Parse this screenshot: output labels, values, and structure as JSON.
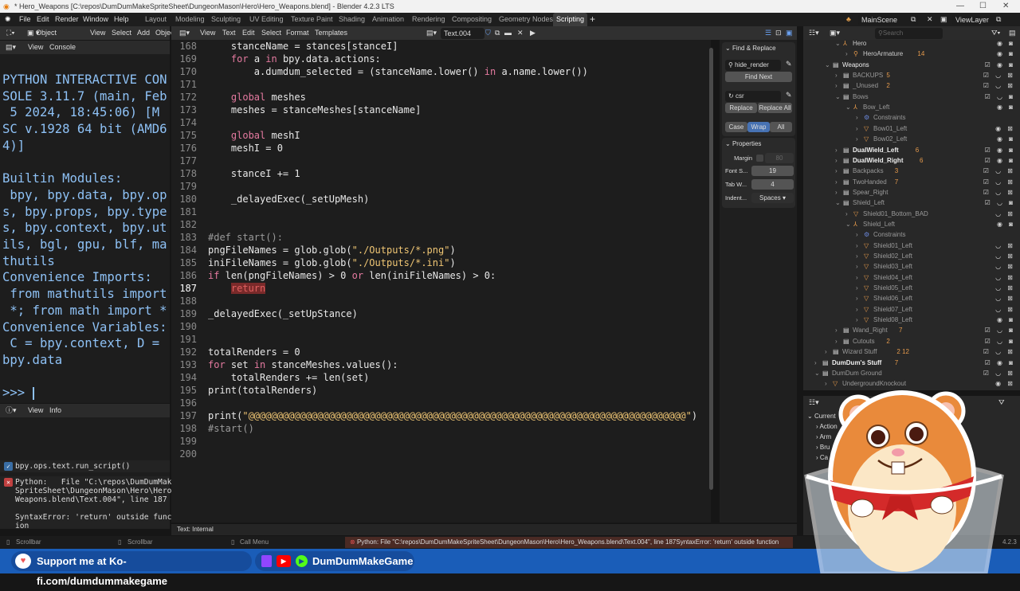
{
  "title": "* Hero_Weapons [C:\\repos\\DumDumMakeSpriteSheet\\DungeonMason\\Hero\\Hero_Weapons.blend] - Blender 4.2.3 LTS",
  "menu": [
    "File",
    "Edit",
    "Render",
    "Window",
    "Help"
  ],
  "workspaces": [
    "Layout",
    "Modeling",
    "Sculpting",
    "UV Editing",
    "Texture Paint",
    "Shading",
    "Animation",
    "Rendering",
    "Compositing",
    "Geometry Nodes",
    "Scripting"
  ],
  "active_workspace": "Scripting",
  "scene": "MainScene",
  "view_layer": "ViewLayer",
  "viewport_header": {
    "mode": "Object Mode",
    "items": [
      "View",
      "Select",
      "Add",
      "Objec"
    ]
  },
  "console_header": {
    "items": [
      "View",
      "Console"
    ]
  },
  "console_text": "PYTHON INTERACTIVE CON\nSOLE 3.11.7 (main, Feb\n 5 2024, 18:45:06) [M\nSC v.1928 64 bit (AMD6\n4)]\n\nBuiltin Modules:\n bpy, bpy.data, bpy.op\ns, bpy.props, bpy.type\ns, bpy.context, bpy.ut\nils, bgl, gpu, blf, ma\nthutils\nConvenience Imports:\n from mathutils import\n *; from math import *\nConvenience Variables:\n C = bpy.context, D =\nbpy.data\n\n>>> ",
  "info_header": {
    "items": [
      "View",
      "Info"
    ]
  },
  "info": {
    "op": "bpy.ops.text.run_script()",
    "error": "Python:   File \"C:\\repos\\DumDumMake\nSpriteSheet\\DungeonMason\\Hero\\Hero_\nWeapons.blend\\Text.004\", line 187\n\nSyntaxError: 'return' outside funct\nion"
  },
  "text_header": {
    "items": [
      "View",
      "Text",
      "Edit",
      "Select",
      "Format",
      "Templates"
    ],
    "datablock": "Text.004"
  },
  "text_footer": "Text: Internal",
  "code": [
    {
      "n": "168",
      "t": [
        [
          "",
          "    stanceName = stances[stanceI]"
        ]
      ]
    },
    {
      "n": "169",
      "t": [
        [
          "",
          "    "
        ],
        [
          "k",
          "for"
        ],
        [
          "",
          " a "
        ],
        [
          "k",
          "in"
        ],
        [
          "",
          " bpy.data.actions:"
        ]
      ]
    },
    {
      "n": "170",
      "t": [
        [
          "",
          "        a.dumdum_selected = (stanceName.lower() "
        ],
        [
          "k",
          "in"
        ],
        [
          "",
          " a.name.lower())"
        ]
      ]
    },
    {
      "n": "171",
      "t": []
    },
    {
      "n": "172",
      "t": [
        [
          "",
          "    "
        ],
        [
          "k",
          "global"
        ],
        [
          "",
          " meshes"
        ]
      ]
    },
    {
      "n": "173",
      "t": [
        [
          "",
          "    meshes = stanceMeshes[stanceName]"
        ]
      ]
    },
    {
      "n": "174",
      "t": []
    },
    {
      "n": "175",
      "t": [
        [
          "",
          "    "
        ],
        [
          "k",
          "global"
        ],
        [
          "",
          " meshI"
        ]
      ]
    },
    {
      "n": "176",
      "t": [
        [
          "",
          "    meshI = 0"
        ]
      ]
    },
    {
      "n": "177",
      "t": []
    },
    {
      "n": "178",
      "t": [
        [
          "",
          "    stanceI += 1"
        ]
      ]
    },
    {
      "n": "179",
      "t": []
    },
    {
      "n": "180",
      "t": [
        [
          "",
          "    _delayedExec(_setUpMesh)"
        ]
      ]
    },
    {
      "n": "181",
      "t": []
    },
    {
      "n": "182",
      "t": []
    },
    {
      "n": "183",
      "t": [
        [
          "c",
          "#def start():"
        ]
      ]
    },
    {
      "n": "184",
      "t": [
        [
          "",
          "pngFileNames = glob.glob("
        ],
        [
          "s",
          "\"./Outputs/*.png\""
        ],
        [
          "",
          ")"
        ]
      ]
    },
    {
      "n": "185",
      "t": [
        [
          "",
          "iniFileNames = glob.glob("
        ],
        [
          "s",
          "\"./Outputs/*.ini\""
        ],
        [
          "",
          ")"
        ]
      ]
    },
    {
      "n": "186",
      "t": [
        [
          "k",
          "if"
        ],
        [
          "",
          " len(pngFileNames) > 0 "
        ],
        [
          "k",
          "or"
        ],
        [
          "",
          " len(iniFileNames) > 0:"
        ]
      ]
    },
    {
      "n": "187",
      "t": [
        [
          "",
          "    "
        ],
        [
          "e",
          "return"
        ]
      ]
    },
    {
      "n": "188",
      "t": []
    },
    {
      "n": "189",
      "t": [
        [
          "",
          "_delayedExec(_setUpStance)"
        ]
      ]
    },
    {
      "n": "190",
      "t": []
    },
    {
      "n": "191",
      "t": []
    },
    {
      "n": "192",
      "t": [
        [
          "",
          "totalRenders = 0"
        ]
      ]
    },
    {
      "n": "193",
      "t": [
        [
          "k",
          "for"
        ],
        [
          "",
          " set "
        ],
        [
          "k",
          "in"
        ],
        [
          "",
          " stanceMeshes.values():"
        ]
      ]
    },
    {
      "n": "194",
      "t": [
        [
          "",
          "    totalRenders += len(set)"
        ]
      ]
    },
    {
      "n": "195",
      "t": [
        [
          "",
          "print(totalRenders)"
        ]
      ]
    },
    {
      "n": "196",
      "t": []
    },
    {
      "n": "197",
      "t": [
        [
          "",
          "print("
        ],
        [
          "s",
          "\"@@@@@@@@@@@@@@@@@@@@@@@@@@@@@@@@@@@@@@@@@@@@@@@@@@@@@@@@@@@@@@@@@@@@@@@@@@@@\""
        ],
        [
          "",
          ")"
        ]
      ]
    },
    {
      "n": "198",
      "t": [
        [
          "c",
          "#start()"
        ]
      ]
    },
    {
      "n": "199",
      "t": []
    },
    {
      "n": "200",
      "t": []
    }
  ],
  "find_replace": {
    "title": "Find & Replace",
    "find": "hide_render",
    "find_next": "Find Next",
    "replace": "csr",
    "replace_btn": "Replace",
    "replace_all": "Replace All",
    "case": "Case",
    "wrap": "Wrap",
    "all": "All"
  },
  "properties": {
    "title": "Properties",
    "margin_label": "Margin",
    "margin": "80",
    "font_label": "Font S...",
    "font": "19",
    "tab_label": "Tab W...",
    "tab": "4",
    "indent_label": "Indent...",
    "indent": "Spaces"
  },
  "outliner": {
    "search_placeholder": "Search",
    "rows": [
      {
        "lvl": 2,
        "icon": "armature",
        "name": "Hero",
        "open": true,
        "vis": "◉ ◙"
      },
      {
        "lvl": 3,
        "icon": "armature-obj",
        "name": "HeroArmature",
        "badge": "14",
        "vis": "◉ ◙"
      },
      {
        "lvl": 1,
        "icon": "collection",
        "name": "Weapons",
        "open": true,
        "bright": true,
        "vis": "☑ ◉ ◙"
      },
      {
        "lvl": 2,
        "icon": "collection",
        "name": "BACKUPS",
        "dim": true,
        "badge": "5",
        "vis": "☑ ◡ ⊠"
      },
      {
        "lvl": 2,
        "icon": "collection",
        "name": "_Unused",
        "dim": true,
        "badge": "2",
        "vis": "☑ ◡ ⊠"
      },
      {
        "lvl": 2,
        "icon": "collection",
        "name": "Bows",
        "dim": true,
        "open": true,
        "vis": "☑ ◡ ◙"
      },
      {
        "lvl": 3,
        "icon": "armature",
        "name": "Bow_Left",
        "dim": true,
        "open": true,
        "vis": "◉ ◙"
      },
      {
        "lvl": 4,
        "icon": "constraint",
        "name": "Constraints",
        "dim": true,
        "vis": ""
      },
      {
        "lvl": 4,
        "icon": "mesh",
        "name": "Bow01_Left",
        "dim": true,
        "vis": "◉ ⊠"
      },
      {
        "lvl": 4,
        "icon": "mesh",
        "name": "Bow02_Left",
        "dim": true,
        "vis": "◉ ◙"
      },
      {
        "lvl": 2,
        "icon": "collection",
        "name": "DualWield_Left",
        "bold": true,
        "badge": "6",
        "vis": "☑ ◉ ◙"
      },
      {
        "lvl": 2,
        "icon": "collection",
        "name": "DualWield_Right",
        "bold": true,
        "badge": "6",
        "vis": "☑ ◉ ◙"
      },
      {
        "lvl": 2,
        "icon": "collection",
        "name": "Backpacks",
        "dim": true,
        "badge": "3",
        "vis": "☑ ◡ ⊠"
      },
      {
        "lvl": 2,
        "icon": "collection",
        "name": "TwoHanded",
        "dim": true,
        "badge": "7",
        "vis": "☑ ◡ ⊠"
      },
      {
        "lvl": 2,
        "icon": "collection",
        "name": "Spear_Right",
        "dim": true,
        "vis": "☑ ◡ ⊠"
      },
      {
        "lvl": 2,
        "icon": "collection",
        "name": "Shield_Left",
        "dim": true,
        "open": true,
        "vis": "☑ ◡ ◙"
      },
      {
        "lvl": 3,
        "icon": "mesh",
        "name": "Shield01_Bottom_BAD",
        "dim": true,
        "vis": "◡ ⊠"
      },
      {
        "lvl": 3,
        "icon": "armature",
        "name": "Shield_Left",
        "dim": true,
        "open": true,
        "vis": "◉ ◙"
      },
      {
        "lvl": 4,
        "icon": "constraint",
        "name": "Constraints",
        "dim": true,
        "vis": ""
      },
      {
        "lvl": 4,
        "icon": "mesh",
        "name": "Shield01_Left",
        "dim": true,
        "vis": "◡ ⊠"
      },
      {
        "lvl": 4,
        "icon": "mesh",
        "name": "Shield02_Left",
        "dim": true,
        "vis": "◡ ⊠"
      },
      {
        "lvl": 4,
        "icon": "mesh",
        "name": "Shield03_Left",
        "dim": true,
        "vis": "◡ ⊠"
      },
      {
        "lvl": 4,
        "icon": "mesh",
        "name": "Shield04_Left",
        "dim": true,
        "vis": "◡ ⊠"
      },
      {
        "lvl": 4,
        "icon": "mesh",
        "name": "Shield05_Left",
        "dim": true,
        "vis": "◡ ⊠"
      },
      {
        "lvl": 4,
        "icon": "mesh",
        "name": "Shield06_Left",
        "dim": true,
        "vis": "◡ ⊠"
      },
      {
        "lvl": 4,
        "icon": "mesh",
        "name": "Shield07_Left",
        "dim": true,
        "vis": "◡ ⊠"
      },
      {
        "lvl": 4,
        "icon": "mesh",
        "name": "Shield08_Left",
        "dim": true,
        "vis": "◉ ◙"
      },
      {
        "lvl": 2,
        "icon": "collection",
        "name": "Wand_Right",
        "dim": true,
        "badge": "7",
        "vis": "☑ ◡ ◙"
      },
      {
        "lvl": 2,
        "icon": "collection",
        "name": "Cutouts",
        "dim": true,
        "badge": "2",
        "vis": "☑ ◡ ◙"
      },
      {
        "lvl": 1,
        "icon": "collection",
        "name": "Wizard Stuff",
        "dim": true,
        "badge": "2 12",
        "vis": "☑ ◡ ⊠"
      },
      {
        "lvl": 0,
        "icon": "collection",
        "name": "DumDum's Stuff",
        "bold": true,
        "badge": "7",
        "vis": "☑ ◉ ◙"
      },
      {
        "lvl": 0,
        "icon": "collection",
        "name": "DumDum Ground",
        "dim": true,
        "open": true,
        "vis": "☑ ◡ ⊠"
      },
      {
        "lvl": 1,
        "icon": "mesh",
        "name": "UndergroundKnockout",
        "dim": true,
        "vis": "◉ ⊠"
      }
    ]
  },
  "blend_file_view": [
    "Current",
    "Action",
    "Arm",
    "Bru",
    "Ca"
  ],
  "statusbar": {
    "scroll1": "Scrollbar",
    "scroll2": "Scrollbar",
    "call_menu": "Call Menu",
    "error": "Python:  File \"C:\\repos\\DumDumMakeSpriteSheet\\DungeonMason\\Hero\\Hero_Weapons.blend\\Text.004\", line 187SyntaxError: 'return' outside function",
    "version": "4.2.3"
  },
  "banner": {
    "kofi": "Support me at Ko-fi.com/dumdummakegame",
    "channel": "DumDumMakeGame"
  },
  "colors": {
    "accent": "#4772b3",
    "keyword": "#e57aa0",
    "string": "#f0c674",
    "banner": "#1a5db8"
  }
}
